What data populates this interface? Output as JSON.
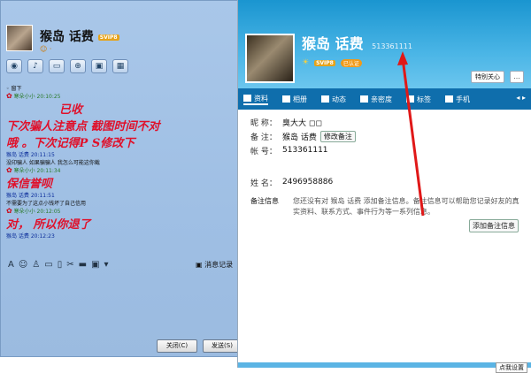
{
  "chat": {
    "title": "猴岛 话费",
    "vip": "SVIP8",
    "messages": [
      {
        "kind": "sys",
        "text": "◦ 窗下"
      },
      {
        "kind": "hdr2",
        "text": "寒朵小小 20:10:25"
      },
      {
        "kind": "red",
        "text": "已收"
      },
      {
        "kind": "red",
        "text": "下次骗人注意点    截图时间不对"
      },
      {
        "kind": "red",
        "text": "哦    。下次记得P S修改下"
      },
      {
        "kind": "hdr",
        "text": "猴岛 话费 20:11:15"
      },
      {
        "kind": "txt",
        "text": "没印骗人 如果骗骗人  我怎么可能这你截"
      },
      {
        "kind": "hdr2",
        "text": "寒朵小小 20:11:34"
      },
      {
        "kind": "red",
        "text": "保信誉呗"
      },
      {
        "kind": "hdr",
        "text": "猴岛 话费 20:11:51"
      },
      {
        "kind": "txt",
        "text": "不需要为了这点小钱坏了自己信用"
      },
      {
        "kind": "hdr2",
        "text": "寒朵小小 20:12:05"
      },
      {
        "kind": "red",
        "text": "对，   所以你退了"
      },
      {
        "kind": "hdr",
        "text": "猴岛 话费 20:12:23"
      }
    ],
    "records_label": "消息记录",
    "close_label": "关闭(C)",
    "send_label": "发送(S)"
  },
  "profile": {
    "name": "猴岛 话费",
    "qq_number": "513361111",
    "vip": "SVIP8",
    "badge": "已认证",
    "special_label": "特别关心",
    "tabs": [
      "资料",
      "相册",
      "动态",
      "亲密度",
      "标签",
      "手机"
    ],
    "fields": {
      "nickname_label": "昵  称：",
      "nickname_value": "臭大大 ◻◻",
      "remark_label": "备  注：",
      "remark_value": "猴岛 话费",
      "edit_remark": "修改备注",
      "account_label": "帐  号：",
      "account_value": "513361111",
      "name_label": "姓  名：",
      "name_value": "2496958886"
    },
    "remark_info_label": "备注信息",
    "remark_info_text": "您还没有对 猴岛 话费 添加备注信息。备注信息可以帮助您记录好友的真实资料、联系方式、事件行为等一系列信息。",
    "add_remark": "添加备注信息"
  },
  "corner_text": "点我设置"
}
